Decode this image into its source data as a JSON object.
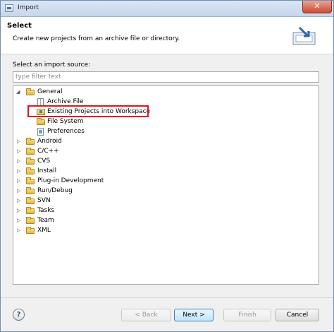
{
  "window": {
    "title": "Import",
    "close_label": "✕"
  },
  "banner": {
    "title": "Select",
    "description": "Create new projects from an archive file or directory."
  },
  "source": {
    "label": "Select an import source:",
    "filter_placeholder": "type filter text"
  },
  "tree": {
    "general": {
      "label": "General",
      "expanded": true
    },
    "general_children": [
      {
        "label": "Archive File",
        "icon": "archive-file-icon"
      },
      {
        "label": "Existing Projects into Workspace",
        "icon": "project-icon",
        "highlighted": true
      },
      {
        "label": "File System",
        "icon": "folder-icon"
      },
      {
        "label": "Preferences",
        "icon": "preferences-icon"
      }
    ],
    "categories": [
      "Android",
      "C/C++",
      "CVS",
      "Install",
      "Plug-in Development",
      "Run/Debug",
      "SVN",
      "Tasks",
      "Team",
      "XML"
    ]
  },
  "buttons": {
    "help": "?",
    "back": "< Back",
    "next": "Next >",
    "finish": "Finish",
    "cancel": "Cancel"
  },
  "colors": {
    "highlight_border": "#e0151b",
    "next_button": "#bee6fd"
  }
}
